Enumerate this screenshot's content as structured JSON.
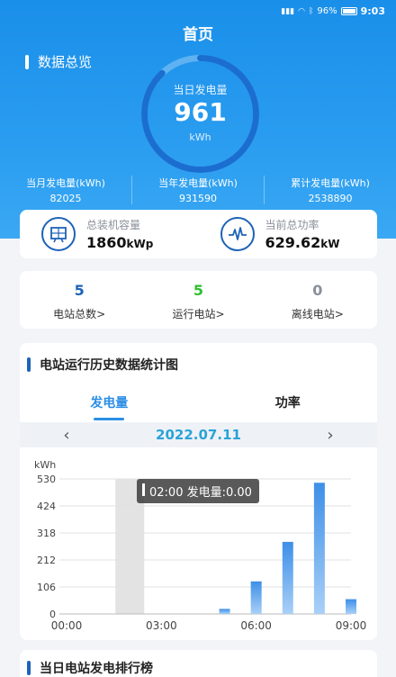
{
  "status_bar": {
    "battery": "96%",
    "time": "9:03"
  },
  "page_title": "首页",
  "overview": {
    "title": "数据总览",
    "gauge": {
      "label": "当日发电量",
      "value": "961",
      "unit": "kWh",
      "fill_fraction": 0.88
    },
    "stats": [
      {
        "label": "当月发电量(kWh)",
        "value": "82025"
      },
      {
        "label": "当年发电量(kWh)",
        "value": "931590"
      },
      {
        "label": "累计发电量(kWh)",
        "value": "2538890"
      }
    ]
  },
  "capacity": {
    "installed": {
      "label": "总装机容量",
      "value": "1860",
      "unit": "kWp",
      "icon": "solar-panel-icon"
    },
    "power": {
      "label": "当前总功率",
      "value": "629.62",
      "unit": "kW",
      "icon": "pulse-wave-icon"
    }
  },
  "stations": [
    {
      "count": "5",
      "label": "电站总数>",
      "color": "#1d63b8"
    },
    {
      "count": "5",
      "label": "运行电站>",
      "color": "#2fbf2f"
    },
    {
      "count": "0",
      "label": "离线电站>",
      "color": "#8a8f99"
    }
  ],
  "history_chart": {
    "title": "电站运行历史数据统计图",
    "tabs": [
      "发电量",
      "功率"
    ],
    "active_tab": 0,
    "date": "2022.07.11",
    "tooltip": "02:00 发电量:0.00",
    "colors": {
      "bar": "#3d8fe8",
      "highlight": "#e3e3e3"
    }
  },
  "chart_data": {
    "type": "bar",
    "ylabel": "kWh",
    "yticks": [
      0,
      106,
      212,
      318,
      424,
      530
    ],
    "ylim": [
      0,
      530
    ],
    "xticks": [
      "00:00",
      "03:00",
      "06:00",
      "09:00"
    ],
    "x_hours": [
      5,
      6,
      7,
      8,
      9
    ],
    "values": [
      20,
      128,
      283,
      515,
      58
    ],
    "highlight_hour": 2,
    "grid": true
  },
  "bottom_section": {
    "title": "当日电站发电排行榜"
  }
}
